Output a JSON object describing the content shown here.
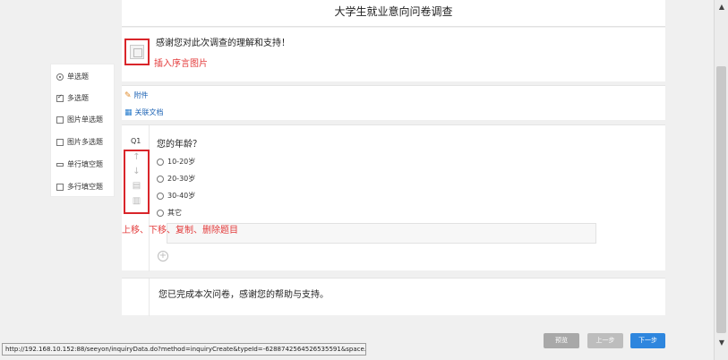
{
  "survey": {
    "title": "大学生就业意向问卷调查",
    "intro_text": "感谢您对此次调查的理解和支持！",
    "intro_image_annotation": "插入序言图片",
    "attachment_label": "附件",
    "related_doc_label": "关联文档"
  },
  "question": {
    "number": "Q1",
    "title": "您的年龄？",
    "options": [
      "10-20岁",
      "20-30岁",
      "30-40岁",
      "其它"
    ],
    "controls_annotation": "上移、下移、复制、删除题目",
    "add_symbol": "+"
  },
  "ending": {
    "text": "您已完成本次问卷，感谢您的帮助与支持。"
  },
  "palette": {
    "items": [
      "单选题",
      "多选题",
      "图片单选题",
      "图片多选题",
      "单行填空题",
      "多行填空题"
    ]
  },
  "buttons": {
    "preview": "预览",
    "prev": "上一步",
    "next": "下一步"
  },
  "statusbar": {
    "url": "http://192.168.10.152:88/seeyon/inquiryData.do?method=inquiryCreate&typeId=-6288742564526535591&space..."
  },
  "icons": {
    "move_up": "arrow-up-icon",
    "move_down": "arrow-down-icon",
    "copy": "copy-icon",
    "delete": "trash-icon"
  },
  "colors": {
    "annotation_red": "#d9252a",
    "next_button_blue": "#2e86de",
    "link_blue": "#1e64b5"
  }
}
